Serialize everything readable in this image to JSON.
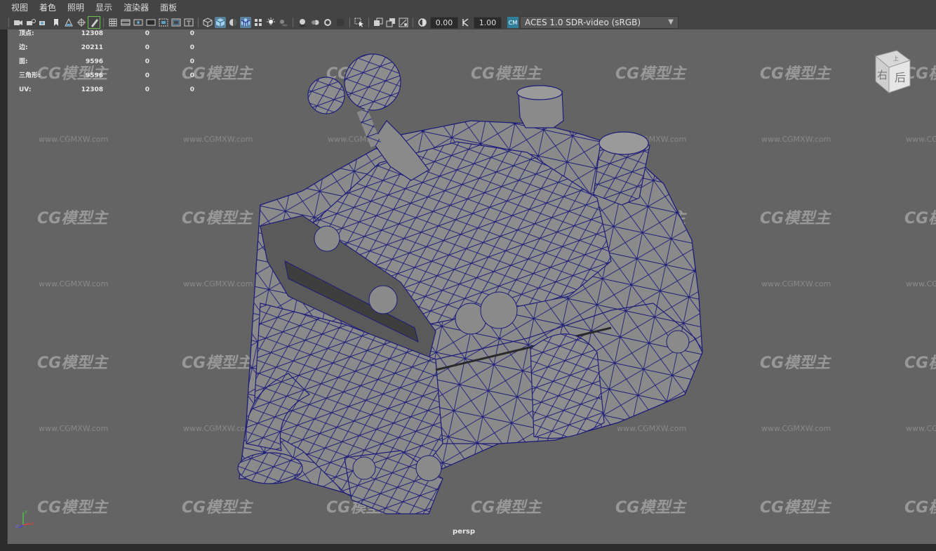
{
  "menu": [
    "视图",
    "着色",
    "照明",
    "显示",
    "渲染器",
    "面板"
  ],
  "toolbar": {
    "exposure_value": "0.00",
    "gamma_value": "1.00",
    "colorspace_badge": "CM",
    "colorspace_label": "ACES 1.0 SDR-video (sRGB)",
    "icons": [
      "camera-select-icon",
      "camera-lock-icon",
      "camera-attributes-icon",
      "bookmark-icon",
      "image-plane-icon",
      "two-d-pan-icon",
      "grease-pencil-icon",
      "grid-icon",
      "film-gate-icon",
      "resolution-gate-icon",
      "gate-mask-icon",
      "field-chart-icon",
      "safe-action-icon",
      "safe-title-icon",
      "wireframe-icon",
      "smooth-shade-icon",
      "default-material-icon",
      "wireframe-on-shaded-icon",
      "xray-icon",
      "use-all-lights-icon",
      "shadows-icon",
      "screen-space-ao-icon",
      "motion-blur-icon",
      "multisample-aa-icon",
      "depth-of-field-icon",
      "isolate-select-icon",
      "xray-joints-icon",
      "xray-active-icon",
      "backface-culling-icon",
      "exposure-icon",
      "gamma-icon"
    ]
  },
  "hud": {
    "rows": [
      {
        "label": "顶点:",
        "v1": "12308",
        "v2": "0",
        "v3": "0"
      },
      {
        "label": "边:",
        "v1": "20211",
        "v2": "0",
        "v3": "0"
      },
      {
        "label": "面:",
        "v1": "9596",
        "v2": "0",
        "v3": "0"
      },
      {
        "label": "三角形:",
        "v1": "9596",
        "v2": "0",
        "v3": "0"
      },
      {
        "label": "UV:",
        "v1": "12308",
        "v2": "0",
        "v3": "0"
      }
    ]
  },
  "viewcube": {
    "right": "右",
    "back": "后",
    "top": "上"
  },
  "axis": {
    "x": "x",
    "y": "y",
    "z": "z"
  },
  "camera_label": "persp",
  "watermark": {
    "logo": "CG模型主",
    "url": "www.CGMXW.com"
  },
  "colors": {
    "viewport_bg": "#646464",
    "mesh_fill": "#8a8a8a",
    "wire": "#1c1c7a",
    "menubar": "#444444"
  }
}
